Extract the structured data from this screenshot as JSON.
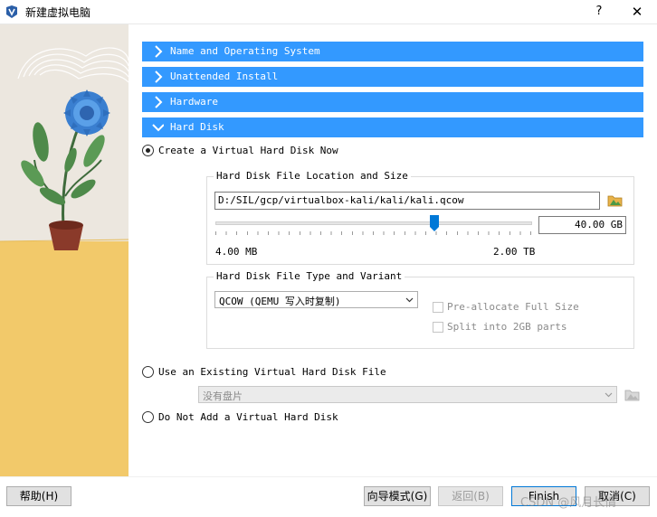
{
  "window": {
    "title": "新建虚拟电脑",
    "help_label": "?",
    "close_label": "✕"
  },
  "sections": [
    {
      "label": "Name and Operating System",
      "expanded": false
    },
    {
      "label": "Unattended Install",
      "expanded": false
    },
    {
      "label": "Hardware",
      "expanded": false
    },
    {
      "label": "Hard Disk",
      "expanded": true
    }
  ],
  "hard_disk": {
    "option_create": {
      "label": "Create a Virtual Hard Disk Now",
      "checked": true
    },
    "location_group": {
      "title": "Hard Disk File Location and Size",
      "path_value": "D:/SIL/gcp/virtualbox-kali/kali/kali.qcow",
      "size_value": "40.00 GB",
      "min_label": "4.00 MB",
      "max_label": "2.00 TB"
    },
    "type_group": {
      "title": "Hard Disk File Type and Variant",
      "type_value": "QCOW (QEMU 写入时复制)",
      "preallocate_label": "Pre-allocate Full Size",
      "split_label": "Split into 2GB parts"
    },
    "option_existing": {
      "label": "Use an Existing Virtual Hard Disk File",
      "checked": false,
      "disk_value": "没有盘片"
    },
    "option_none": {
      "label": "Do Not Add a Virtual Hard Disk",
      "checked": false
    }
  },
  "footer": {
    "help_label": "帮助(H)",
    "guided_label": "向导模式(G)",
    "back_label": "返回(B)",
    "finish_label": "Finish",
    "cancel_label": "取消(C)"
  },
  "watermark": "CSDN @风月长情",
  "colors": {
    "accent": "#3399ff",
    "slider": "#0078d7"
  }
}
